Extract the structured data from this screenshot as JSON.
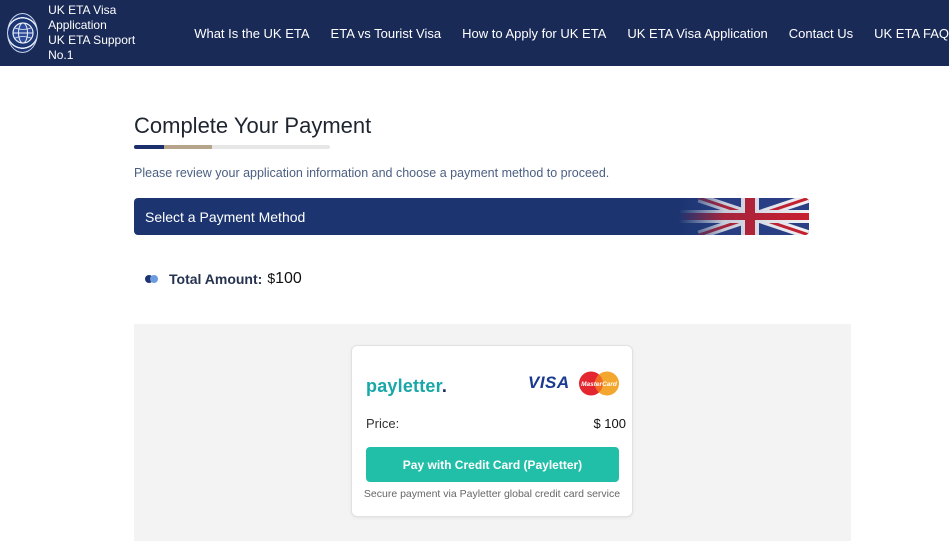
{
  "header": {
    "brand_line1": "UK ETA Visa Application",
    "brand_line2": "UK ETA Support No.1",
    "logo_icon": "globe-emblem-icon",
    "nav": [
      {
        "label": "What Is the UK ETA"
      },
      {
        "label": "ETA vs Tourist Visa"
      },
      {
        "label": "How to Apply for UK ETA"
      },
      {
        "label": "UK ETA Visa Application"
      },
      {
        "label": "Contact Us"
      },
      {
        "label": "UK ETA FAQ"
      }
    ]
  },
  "page": {
    "title": "Complete Your Payment",
    "subtitle": "Please review your application information and choose a payment method to proceed.",
    "method_banner": "Select a Payment Method",
    "total_label": "Total Amount:",
    "total_currency": "$",
    "total_value": "100"
  },
  "payment_card": {
    "provider_text": "payletter",
    "provider_dot": ".",
    "visa_text": "VISA",
    "mastercard_text": "MasterCard",
    "price_label": "Price:",
    "price_value": "$ 100",
    "button_label": "Pay with Credit Card (Payletter)",
    "secure_note": "Secure payment via Payletter global credit card service"
  },
  "colors": {
    "header_bg": "#1a2a57",
    "banner_bg": "#1c3571",
    "pay_button": "#21bfa8",
    "payletter_teal": "#19a7a7"
  }
}
